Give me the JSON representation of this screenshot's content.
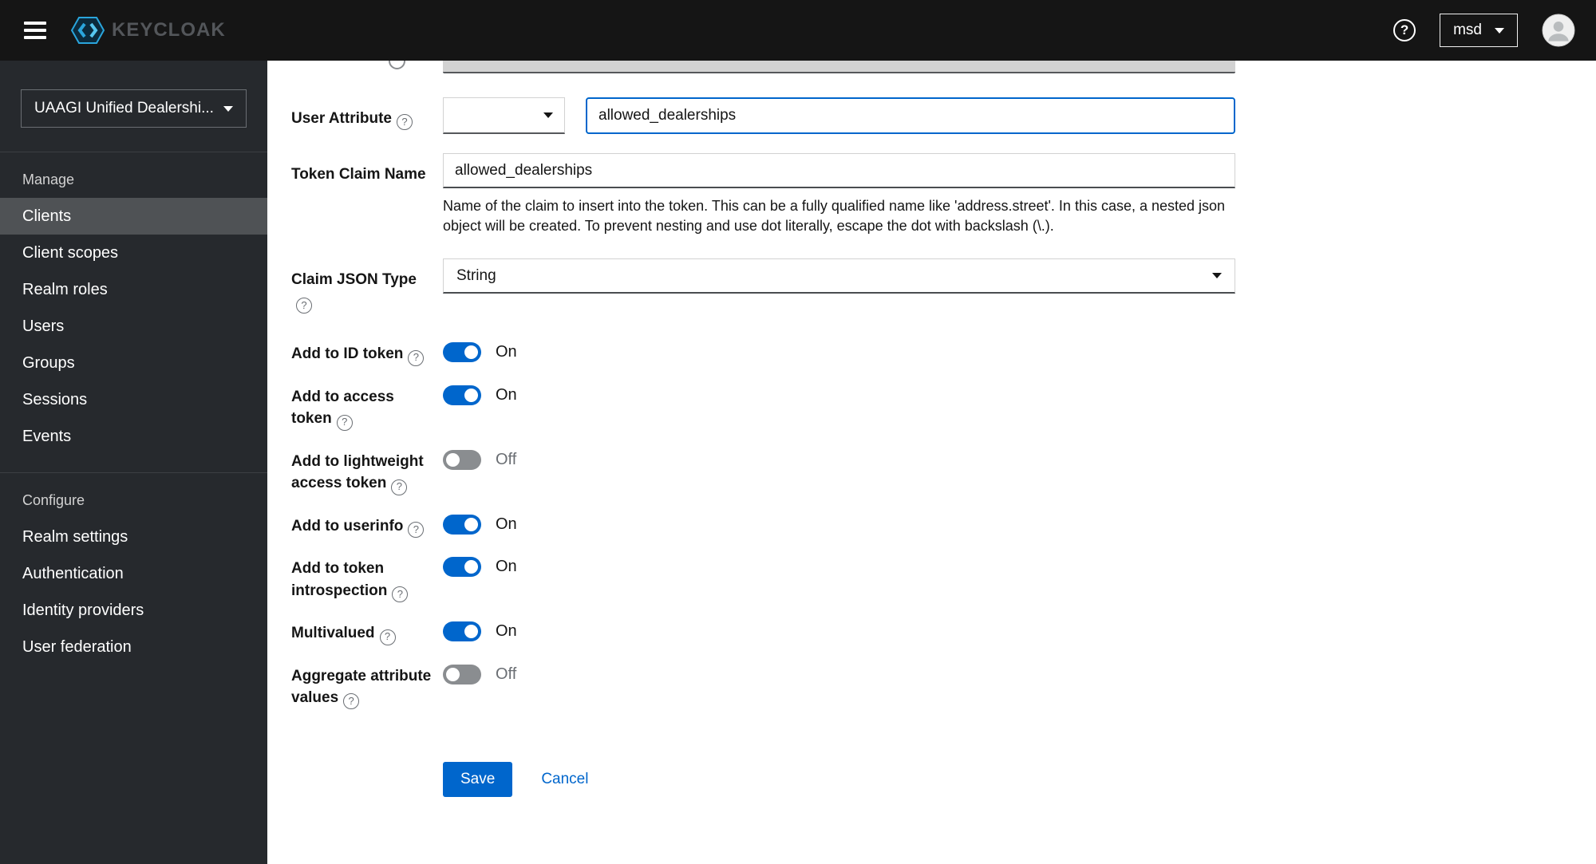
{
  "header": {
    "brand_text": "KEYCLOAK",
    "username": "msd",
    "help_glyph": "?"
  },
  "sidebar": {
    "realm": "UAAGI Unified Dealershi...",
    "sections": [
      {
        "title": "Manage",
        "items": [
          "Clients",
          "Client scopes",
          "Realm roles",
          "Users",
          "Groups",
          "Sessions",
          "Events"
        ],
        "selected": "Clients"
      },
      {
        "title": "Configure",
        "items": [
          "Realm settings",
          "Authentication",
          "Identity providers",
          "User federation"
        ]
      }
    ]
  },
  "form": {
    "user_attribute": {
      "label": "User Attribute",
      "select_value": "",
      "input_value": "allowed_dealerships"
    },
    "token_claim_name": {
      "label": "Token Claim Name",
      "value": "allowed_dealerships",
      "help": "Name of the claim to insert into the token. This can be a fully qualified name like 'address.street'. In this case, a nested json object will be created. To prevent nesting and use dot literally, escape the dot with backslash (\\.)."
    },
    "claim_json_type": {
      "label": "Claim JSON Type",
      "value": "String"
    },
    "toggles": [
      {
        "label": "Add to ID token",
        "state": "On",
        "on": true
      },
      {
        "label": "Add to access token",
        "state": "On",
        "on": true
      },
      {
        "label": "Add to lightweight access token",
        "state": "Off",
        "on": false
      },
      {
        "label": "Add to userinfo",
        "state": "On",
        "on": true
      },
      {
        "label": "Add to token introspection",
        "state": "On",
        "on": true
      },
      {
        "label": "Multivalued",
        "state": "On",
        "on": true
      },
      {
        "label": "Aggregate attribute values",
        "state": "Off",
        "on": false
      }
    ],
    "actions": {
      "save": "Save",
      "cancel": "Cancel"
    },
    "help_glyph": "?"
  }
}
